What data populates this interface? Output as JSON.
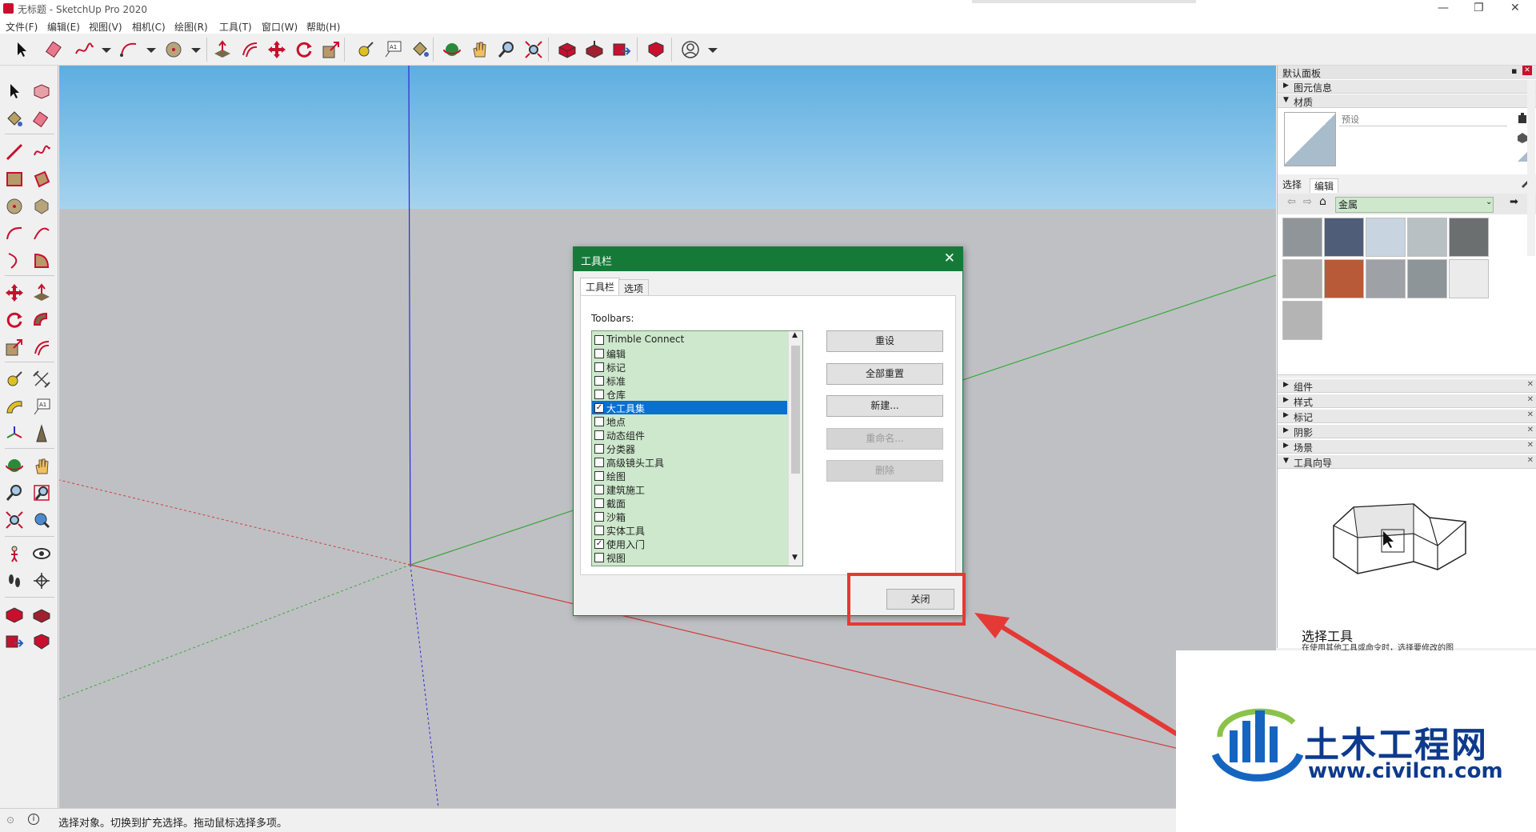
{
  "window": {
    "title": "无标题 - SketchUp Pro 2020",
    "controls": [
      "—",
      "❐",
      "✕"
    ]
  },
  "menu": [
    "文件(F)",
    "编辑(E)",
    "视图(V)",
    "相机(C)",
    "绘图(R)",
    "工具(T)",
    "窗口(W)",
    "帮助(H)"
  ],
  "dialog": {
    "title": "工具栏",
    "tabs": [
      "工具栏",
      "选项"
    ],
    "toolbars_label": "Toolbars:",
    "items": [
      {
        "label": "Trimble Connect",
        "checked": false
      },
      {
        "label": "编辑",
        "checked": false
      },
      {
        "label": "标记",
        "checked": false
      },
      {
        "label": "标准",
        "checked": false
      },
      {
        "label": "仓库",
        "checked": false
      },
      {
        "label": "大工具集",
        "checked": true,
        "selected": true
      },
      {
        "label": "地点",
        "checked": false
      },
      {
        "label": "动态组件",
        "checked": false
      },
      {
        "label": "分类器",
        "checked": false
      },
      {
        "label": "高级镜头工具",
        "checked": false
      },
      {
        "label": "绘图",
        "checked": false
      },
      {
        "label": "建筑施工",
        "checked": false
      },
      {
        "label": "截面",
        "checked": false
      },
      {
        "label": "沙箱",
        "checked": false
      },
      {
        "label": "实体工具",
        "checked": false
      },
      {
        "label": "使用入门",
        "checked": true
      },
      {
        "label": "视图",
        "checked": false
      }
    ],
    "buttons": {
      "reset": "重设",
      "reset_all": "全部重置",
      "new": "新建...",
      "rename": "重命名...",
      "delete": "删除",
      "close": "关闭"
    }
  },
  "panel": {
    "title": "默认面板",
    "entity_info": "图元信息",
    "materials": "材质",
    "material_name_placeholder": "预设",
    "tab_select": "选择",
    "tab_edit": "编辑",
    "library": "金属",
    "swatch_colors": [
      "#8f9598",
      "#4f5d78",
      "#c8d4e0",
      "#b8c0c4",
      "#6c6f70",
      "#b0b0b0",
      "#b85a38",
      "#9ea2a6",
      "#8e9598",
      "#ebebeb",
      "#b4b4b4"
    ],
    "sections": [
      "组件",
      "样式",
      "标记",
      "阴影",
      "场景",
      "工具向导"
    ],
    "instructor_title": "选择工具",
    "instructor_text": "在使用其他工具或命令时，选择要修改的图"
  },
  "status": {
    "text": "选择对象。切换到扩充选择。拖动鼠标选择多项。"
  },
  "watermark": {
    "brand": "土木工程网",
    "url": "www.civilcn.com"
  },
  "colors": {
    "dialog_title": "#157a38",
    "list_bg": "#cde8cc",
    "highlight": "#e53935",
    "axis_red": "#d23c3c",
    "axis_green": "#3aa83a",
    "axis_blue": "#2a2ad0"
  }
}
